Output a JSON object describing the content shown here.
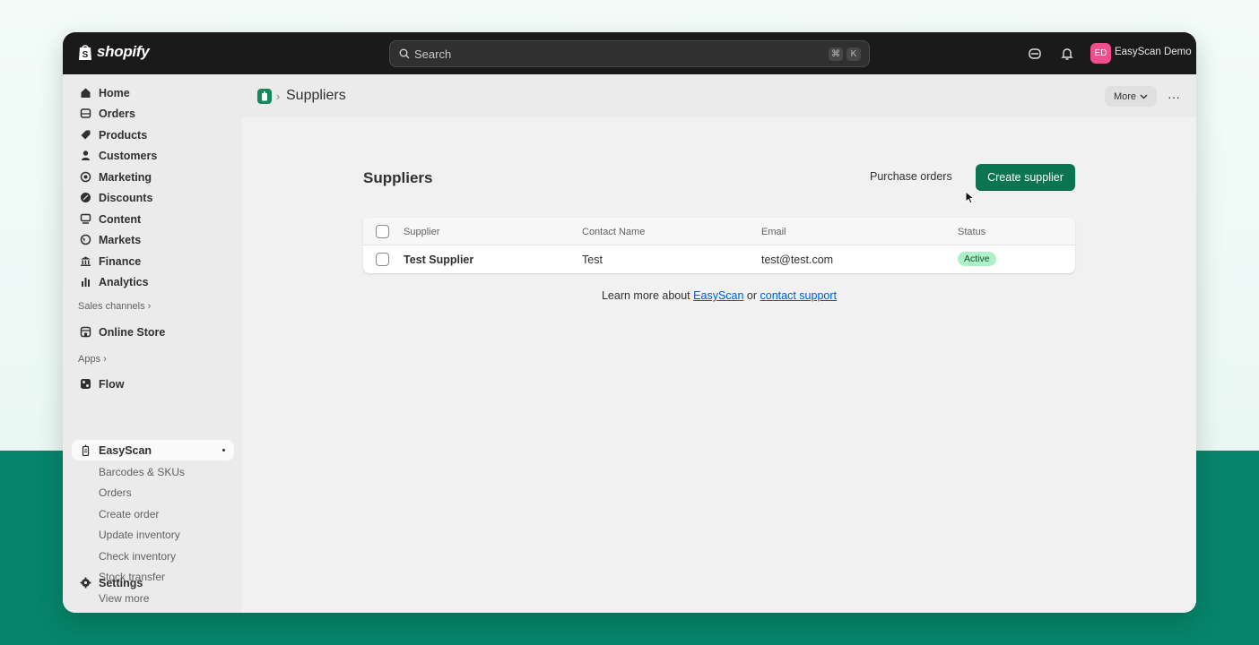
{
  "topbar": {
    "logo_text": "shopify",
    "search_placeholder": "Search",
    "kbd1": "⌘",
    "kbd2": "K",
    "avatar_initials": "ED",
    "store_name": "EasyScan Demo",
    "avatar_color": "#f14e8d"
  },
  "sidebar": {
    "items": [
      {
        "label": "Home",
        "icon": "home-icon"
      },
      {
        "label": "Orders",
        "icon": "orders-icon"
      },
      {
        "label": "Products",
        "icon": "tag-icon"
      },
      {
        "label": "Customers",
        "icon": "person-icon"
      },
      {
        "label": "Marketing",
        "icon": "target-icon"
      },
      {
        "label": "Discounts",
        "icon": "discount-icon"
      },
      {
        "label": "Content",
        "icon": "content-icon"
      },
      {
        "label": "Markets",
        "icon": "globe-icon"
      },
      {
        "label": "Finance",
        "icon": "bank-icon"
      },
      {
        "label": "Analytics",
        "icon": "chart-icon"
      }
    ],
    "sales_channels_label": "Sales channels",
    "online_store_label": "Online Store",
    "apps_label": "Apps",
    "flow_label": "Flow",
    "easyscan_label": "EasyScan",
    "easyscan_subitems": [
      "Barcodes & SKUs",
      "Orders",
      "Create order",
      "Update inventory",
      "Check inventory",
      "Stock transfer",
      "View more"
    ],
    "settings_label": "Settings"
  },
  "header": {
    "breadcrumb": "Suppliers",
    "more_label": "More",
    "dots_label": "···"
  },
  "page": {
    "title": "Suppliers",
    "purchase_orders_label": "Purchase orders",
    "create_supplier_label": "Create supplier",
    "accent_color": "#0b7451"
  },
  "table": {
    "columns": [
      "Supplier",
      "Contact Name",
      "Email",
      "Status"
    ],
    "rows": [
      {
        "supplier": "Test Supplier",
        "contact": "Test",
        "email": "test@test.com",
        "status": "Active"
      }
    ]
  },
  "footer": {
    "prefix": "Learn more about",
    "link1": "EasyScan",
    "middle": "or",
    "link2": "contact support"
  }
}
